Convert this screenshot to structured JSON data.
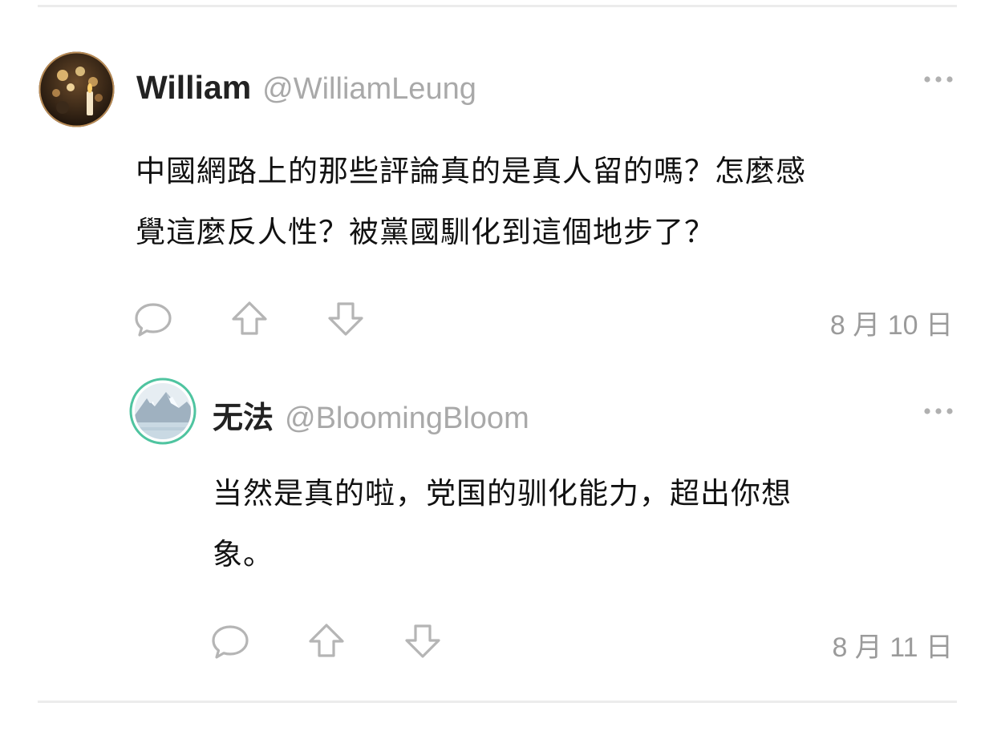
{
  "comments": [
    {
      "display_name": "William",
      "handle": "@WilliamLeung",
      "text_lines": [
        "中國網路上的那些評論真的是真人留的嗎？怎麼感",
        "覺這麼反人性？被黨國馴化到這個地步了？"
      ],
      "date": "8 月 10 日",
      "avatar_icon": "candlelight-avatar"
    },
    {
      "display_name": "无法",
      "handle": "@BloomingBloom",
      "text_lines": [
        "当然是真的啦，党国的驯化能力，超出你想",
        "象。"
      ],
      "date": "8 月 11 日",
      "avatar_icon": "mountain-lake-avatar"
    }
  ],
  "icons": {
    "more": "more-horizontal-icon",
    "reply": "speech-bubble-icon",
    "upvote": "arrow-up-icon",
    "downvote": "arrow-down-icon"
  },
  "colors": {
    "text": "#111111",
    "muted": "#9b9b9b",
    "icon": "#b5b5b5",
    "divider": "#ececec",
    "avatar_ring": "#4fc4a0"
  }
}
